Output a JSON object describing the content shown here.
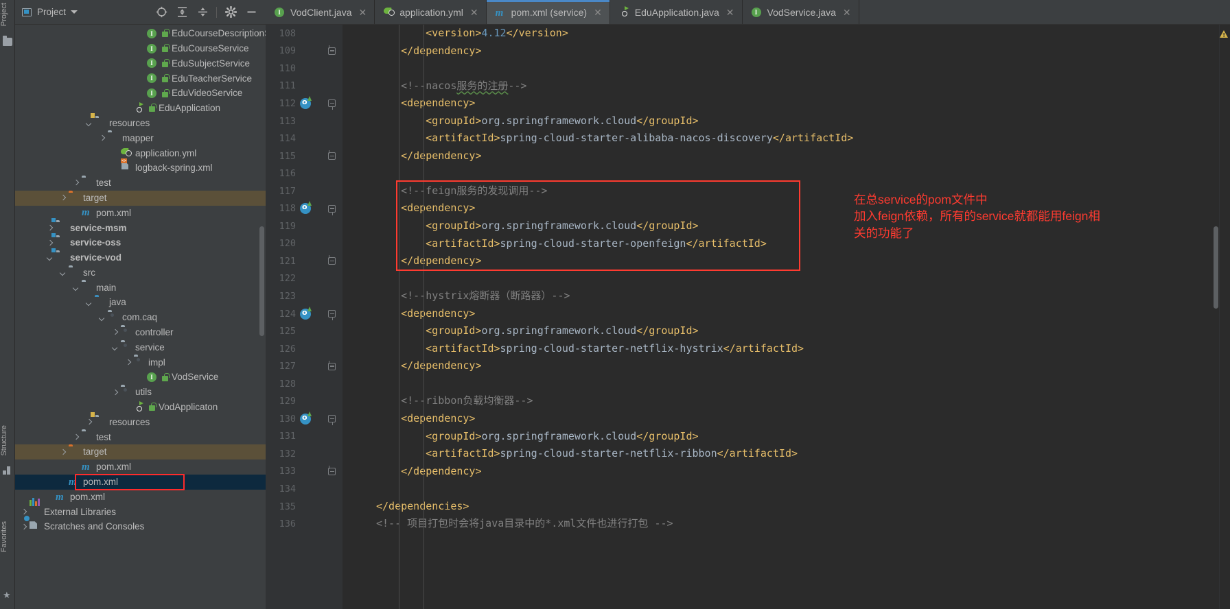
{
  "window": {
    "left_rail": [
      {
        "label": "Project",
        "icon": "project-tool-icon"
      },
      {
        "label": "Structure",
        "icon": "structure-tool-icon"
      },
      {
        "label": "Favorites",
        "icon": "favorites-tool-icon"
      }
    ]
  },
  "project_panel": {
    "title": "Project",
    "toolbar": [
      {
        "name": "locate-icon",
        "glyph": "⊕"
      },
      {
        "name": "expand-all-icon",
        "glyph": "⤓"
      },
      {
        "name": "collapse-all-icon",
        "glyph": "⤒"
      },
      {
        "name": "settings-gear-icon",
        "glyph": "⚙"
      },
      {
        "name": "hide-icon",
        "glyph": "—"
      }
    ],
    "tree": [
      {
        "indent": 10,
        "arrow": "none",
        "icon": "interface-icon",
        "lock": true,
        "label": "EduCourseDescriptionService",
        "bold": false,
        "state": "normal"
      },
      {
        "indent": 10,
        "arrow": "none",
        "icon": "interface-icon",
        "lock": true,
        "label": "EduCourseService",
        "bold": false,
        "state": "normal"
      },
      {
        "indent": 10,
        "arrow": "none",
        "icon": "interface-icon",
        "lock": true,
        "label": "EduSubjectService",
        "bold": false,
        "state": "normal"
      },
      {
        "indent": 10,
        "arrow": "none",
        "icon": "interface-icon",
        "lock": true,
        "label": "EduTeacherService",
        "bold": false,
        "state": "normal"
      },
      {
        "indent": 10,
        "arrow": "none",
        "icon": "interface-icon",
        "lock": true,
        "label": "EduVideoService",
        "bold": false,
        "state": "normal"
      },
      {
        "indent": 9,
        "arrow": "none",
        "icon": "spring-boot-icon",
        "lock": true,
        "label": "EduApplication",
        "bold": false,
        "state": "normal"
      },
      {
        "indent": 6,
        "arrow": "down",
        "icon": "resources-folder-icon",
        "lock": false,
        "label": "resources",
        "bold": false,
        "state": "normal"
      },
      {
        "indent": 7,
        "arrow": "right",
        "icon": "folder-icon",
        "lock": false,
        "label": "mapper",
        "bold": false,
        "state": "normal"
      },
      {
        "indent": 8,
        "arrow": "none",
        "icon": "yaml-file-icon",
        "lock": false,
        "label": "application.yml",
        "bold": false,
        "state": "normal"
      },
      {
        "indent": 8,
        "arrow": "none",
        "icon": "xml-file-icon",
        "lock": false,
        "label": "logback-spring.xml",
        "bold": false,
        "state": "normal"
      },
      {
        "indent": 5,
        "arrow": "right",
        "icon": "folder-icon",
        "lock": false,
        "label": "test",
        "bold": false,
        "state": "normal"
      },
      {
        "indent": 4,
        "arrow": "right",
        "icon": "target-folder-icon",
        "lock": false,
        "label": "target",
        "bold": false,
        "state": "highlight-target"
      },
      {
        "indent": 5,
        "arrow": "none",
        "icon": "maven-file-icon",
        "lock": false,
        "label": "pom.xml",
        "bold": false,
        "state": "normal"
      },
      {
        "indent": 3,
        "arrow": "right",
        "icon": "module-folder-icon",
        "lock": false,
        "label": "service-msm",
        "bold": true,
        "state": "normal"
      },
      {
        "indent": 3,
        "arrow": "right",
        "icon": "module-folder-icon",
        "lock": false,
        "label": "service-oss",
        "bold": true,
        "state": "normal"
      },
      {
        "indent": 3,
        "arrow": "down",
        "icon": "module-folder-icon",
        "lock": false,
        "label": "service-vod",
        "bold": true,
        "state": "normal"
      },
      {
        "indent": 4,
        "arrow": "down",
        "icon": "folder-icon",
        "lock": false,
        "label": "src",
        "bold": false,
        "state": "normal"
      },
      {
        "indent": 5,
        "arrow": "down",
        "icon": "folder-icon",
        "lock": false,
        "label": "main",
        "bold": false,
        "state": "normal"
      },
      {
        "indent": 6,
        "arrow": "down",
        "icon": "source-folder-icon",
        "lock": false,
        "label": "java",
        "bold": false,
        "state": "normal"
      },
      {
        "indent": 7,
        "arrow": "down",
        "icon": "package-icon",
        "lock": false,
        "label": "com.caq",
        "bold": false,
        "state": "normal"
      },
      {
        "indent": 8,
        "arrow": "right",
        "icon": "package-icon",
        "lock": false,
        "label": "controller",
        "bold": false,
        "state": "normal"
      },
      {
        "indent": 8,
        "arrow": "down",
        "icon": "package-icon",
        "lock": false,
        "label": "service",
        "bold": false,
        "state": "normal"
      },
      {
        "indent": 9,
        "arrow": "right",
        "icon": "package-icon",
        "lock": false,
        "label": "impl",
        "bold": false,
        "state": "normal"
      },
      {
        "indent": 10,
        "arrow": "none",
        "icon": "interface-icon",
        "lock": true,
        "label": "VodService",
        "bold": false,
        "state": "normal"
      },
      {
        "indent": 8,
        "arrow": "right",
        "icon": "package-icon",
        "lock": false,
        "label": "utils",
        "bold": false,
        "state": "normal"
      },
      {
        "indent": 9,
        "arrow": "none",
        "icon": "spring-boot-icon",
        "lock": true,
        "label": "VodApplicaton",
        "bold": false,
        "state": "normal"
      },
      {
        "indent": 6,
        "arrow": "right",
        "icon": "resources-folder-icon",
        "lock": false,
        "label": "resources",
        "bold": false,
        "state": "normal"
      },
      {
        "indent": 5,
        "arrow": "right",
        "icon": "folder-icon",
        "lock": false,
        "label": "test",
        "bold": false,
        "state": "normal"
      },
      {
        "indent": 4,
        "arrow": "right",
        "icon": "target-folder-icon",
        "lock": false,
        "label": "target",
        "bold": false,
        "state": "highlight-target"
      },
      {
        "indent": 5,
        "arrow": "none",
        "icon": "maven-file-icon",
        "lock": false,
        "label": "pom.xml",
        "bold": false,
        "state": "normal"
      },
      {
        "indent": 4,
        "arrow": "none",
        "icon": "maven-file-icon",
        "lock": false,
        "label": "pom.xml",
        "bold": false,
        "state": "selected-boxed"
      },
      {
        "indent": 3,
        "arrow": "none",
        "icon": "maven-file-icon",
        "lock": false,
        "label": "pom.xml",
        "bold": false,
        "state": "normal"
      },
      {
        "indent": 1,
        "arrow": "right",
        "icon": "external-libraries-icon",
        "lock": false,
        "label": "External Libraries",
        "bold": false,
        "state": "normal"
      },
      {
        "indent": 1,
        "arrow": "right",
        "icon": "scratches-icon",
        "lock": false,
        "label": "Scratches and Consoles",
        "bold": false,
        "state": "normal"
      }
    ]
  },
  "tabs": [
    {
      "label": "VodClient.java",
      "icon": "interface-icon",
      "active": false,
      "close": "✕"
    },
    {
      "label": "application.yml",
      "icon": "yaml-file-icon",
      "active": false,
      "close": "✕"
    },
    {
      "label": "pom.xml (service)",
      "icon": "maven-file-icon",
      "active": true,
      "close": "✕"
    },
    {
      "label": "EduApplication.java",
      "icon": "spring-boot-icon",
      "active": false,
      "close": "✕"
    },
    {
      "label": "VodService.java",
      "icon": "interface-icon",
      "active": false,
      "close": "✕"
    }
  ],
  "editor": {
    "first_line": 108,
    "lines": [
      {
        "n": 108,
        "indent": 2,
        "tokens": [
          {
            "t": "tag",
            "v": "<version>"
          },
          {
            "t": "num",
            "v": "4.12"
          },
          {
            "t": "tag",
            "v": "</version>"
          }
        ],
        "fold": "none",
        "run": false
      },
      {
        "n": 109,
        "indent": 1,
        "tokens": [
          {
            "t": "tag",
            "v": "</dependency>"
          }
        ],
        "fold": "minus-up",
        "run": false
      },
      {
        "n": 110,
        "indent": 0,
        "tokens": [],
        "fold": "none",
        "run": false
      },
      {
        "n": 111,
        "indent": 1,
        "tokens": [
          {
            "t": "cmt",
            "v": "<!--nacos"
          },
          {
            "t": "cmt-squig",
            "v": "服务的注册"
          },
          {
            "t": "cmt",
            "v": "-->"
          }
        ],
        "fold": "none",
        "run": false
      },
      {
        "n": 112,
        "indent": 1,
        "tokens": [
          {
            "t": "tag",
            "v": "<dependency>"
          }
        ],
        "fold": "minus-dn",
        "run": true
      },
      {
        "n": 113,
        "indent": 2,
        "tokens": [
          {
            "t": "tag",
            "v": "<groupId>"
          },
          {
            "t": "txt",
            "v": "org.springframework.cloud"
          },
          {
            "t": "tag",
            "v": "</groupId>"
          }
        ],
        "fold": "none",
        "run": false
      },
      {
        "n": 114,
        "indent": 2,
        "tokens": [
          {
            "t": "tag",
            "v": "<artifactId>"
          },
          {
            "t": "txt",
            "v": "spring-cloud-starter-alibaba-nacos-discovery"
          },
          {
            "t": "tag",
            "v": "</artifactId>"
          }
        ],
        "fold": "none",
        "run": false
      },
      {
        "n": 115,
        "indent": 1,
        "tokens": [
          {
            "t": "tag",
            "v": "</dependency>"
          }
        ],
        "fold": "minus-up",
        "run": false
      },
      {
        "n": 116,
        "indent": 0,
        "tokens": [],
        "fold": "none",
        "run": false
      },
      {
        "n": 117,
        "indent": 1,
        "tokens": [
          {
            "t": "cmt",
            "v": "<!--feign"
          },
          {
            "t": "cmt",
            "v": "服务的发现调用"
          },
          {
            "t": "cmt",
            "v": "-->"
          }
        ],
        "fold": "none",
        "run": false
      },
      {
        "n": 118,
        "indent": 1,
        "tokens": [
          {
            "t": "tag",
            "v": "<dependency>"
          }
        ],
        "fold": "minus-dn",
        "run": true
      },
      {
        "n": 119,
        "indent": 2,
        "tokens": [
          {
            "t": "tag",
            "v": "<groupId>"
          },
          {
            "t": "txt",
            "v": "org.springframework.cloud"
          },
          {
            "t": "tag",
            "v": "</groupId>"
          }
        ],
        "fold": "none",
        "run": false
      },
      {
        "n": 120,
        "indent": 2,
        "tokens": [
          {
            "t": "tag",
            "v": "<artifactId>"
          },
          {
            "t": "txt",
            "v": "spring-cloud-starter-openfeign"
          },
          {
            "t": "tag",
            "v": "</artifactId>"
          }
        ],
        "fold": "none",
        "run": false
      },
      {
        "n": 121,
        "indent": 1,
        "tokens": [
          {
            "t": "tag",
            "v": "</dependency>"
          }
        ],
        "fold": "minus-up",
        "run": false
      },
      {
        "n": 122,
        "indent": 0,
        "tokens": [],
        "fold": "none",
        "run": false
      },
      {
        "n": 123,
        "indent": 1,
        "tokens": [
          {
            "t": "cmt",
            "v": "<!--hystrix熔断器（断路器）-->"
          }
        ],
        "fold": "none",
        "run": false
      },
      {
        "n": 124,
        "indent": 1,
        "tokens": [
          {
            "t": "tag",
            "v": "<dependency>"
          }
        ],
        "fold": "minus-dn",
        "run": true
      },
      {
        "n": 125,
        "indent": 2,
        "tokens": [
          {
            "t": "tag",
            "v": "<groupId>"
          },
          {
            "t": "txt",
            "v": "org.springframework.cloud"
          },
          {
            "t": "tag",
            "v": "</groupId>"
          }
        ],
        "fold": "none",
        "run": false
      },
      {
        "n": 126,
        "indent": 2,
        "tokens": [
          {
            "t": "tag",
            "v": "<artifactId>"
          },
          {
            "t": "txt",
            "v": "spring-cloud-starter-netflix-hystrix"
          },
          {
            "t": "tag",
            "v": "</artifactId>"
          }
        ],
        "fold": "none",
        "run": false
      },
      {
        "n": 127,
        "indent": 1,
        "tokens": [
          {
            "t": "tag",
            "v": "</dependency>"
          }
        ],
        "fold": "minus-up",
        "run": false
      },
      {
        "n": 128,
        "indent": 0,
        "tokens": [],
        "fold": "none",
        "run": false
      },
      {
        "n": 129,
        "indent": 1,
        "tokens": [
          {
            "t": "cmt",
            "v": "<!--ribbon负载均衡器-->"
          }
        ],
        "fold": "none",
        "run": false
      },
      {
        "n": 130,
        "indent": 1,
        "tokens": [
          {
            "t": "tag",
            "v": "<dependency>"
          }
        ],
        "fold": "minus-dn",
        "run": true
      },
      {
        "n": 131,
        "indent": 2,
        "tokens": [
          {
            "t": "tag",
            "v": "<groupId>"
          },
          {
            "t": "txt",
            "v": "org.springframework.cloud"
          },
          {
            "t": "tag",
            "v": "</groupId>"
          }
        ],
        "fold": "none",
        "run": false
      },
      {
        "n": 132,
        "indent": 2,
        "tokens": [
          {
            "t": "tag",
            "v": "<artifactId>"
          },
          {
            "t": "txt",
            "v": "spring-cloud-starter-netflix-ribbon"
          },
          {
            "t": "tag",
            "v": "</artifactId>"
          }
        ],
        "fold": "none",
        "run": false
      },
      {
        "n": 133,
        "indent": 1,
        "tokens": [
          {
            "t": "tag",
            "v": "</dependency>"
          }
        ],
        "fold": "minus-up",
        "run": false
      },
      {
        "n": 134,
        "indent": 0,
        "tokens": [],
        "fold": "none",
        "run": false
      },
      {
        "n": 135,
        "indent": 0,
        "tokens": [
          {
            "t": "tag",
            "v": "</dependencies>"
          }
        ],
        "fold": "none",
        "run": false
      },
      {
        "n": 136,
        "indent": 0,
        "tokens": [
          {
            "t": "cmt",
            "v": "<!-- 项目打包时会将java目录中的*.xml文件也进行打包 -->"
          }
        ],
        "fold": "none",
        "run": false
      }
    ]
  },
  "annotation": {
    "lines": [
      "在总service的pom文件中",
      "加入feign依赖，所有的service就都能用feign相",
      "关的功能了"
    ],
    "color": "#ff3b30"
  },
  "colors": {
    "accent_blue": "#3592c4",
    "tab_active_underline": "#4a88c7",
    "annotation_red": "#ff3b30",
    "target_row_bg": "#5b5039",
    "selected_row_bg": "#0d293e",
    "editor_bg": "#2b2b2b",
    "panel_bg": "#3c3f41",
    "gutter_bg": "#313335",
    "xml_tag": "#e8bf6a",
    "xml_text": "#a9b7c6",
    "comment": "#808080",
    "number": "#6897bb"
  },
  "status": {
    "warning_icon": "warning-triangle-icon"
  }
}
